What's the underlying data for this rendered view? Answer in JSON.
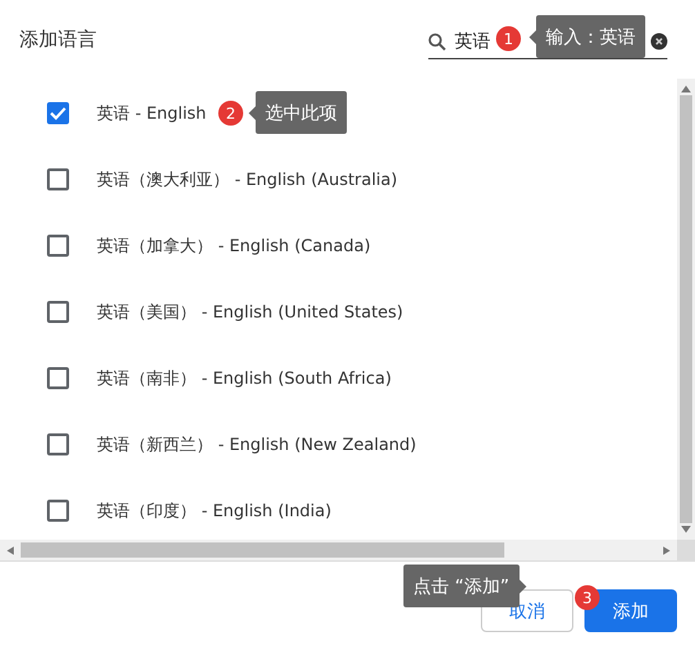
{
  "dialog": {
    "title": "添加语言"
  },
  "search": {
    "value": "英语"
  },
  "languages": [
    {
      "label": "英语 - English",
      "checked": true
    },
    {
      "label": "英语（澳大利亚） - English (Australia)",
      "checked": false
    },
    {
      "label": "英语（加拿大） - English (Canada)",
      "checked": false
    },
    {
      "label": "英语（美国） - English (United States)",
      "checked": false
    },
    {
      "label": "英语（南非） - English (South Africa)",
      "checked": false
    },
    {
      "label": "英语（新西兰） - English (New Zealand)",
      "checked": false
    },
    {
      "label": "英语（印度） - English (India)",
      "checked": false
    }
  ],
  "buttons": [
    {
      "label": "取消",
      "kind": "secondary"
    },
    {
      "label": "添加",
      "kind": "primary"
    }
  ],
  "annotations": [
    {
      "number": "1",
      "text": "输入：英语"
    },
    {
      "number": "2",
      "text": "选中此项"
    },
    {
      "number": "3",
      "text": "点击 “添加”"
    }
  ]
}
